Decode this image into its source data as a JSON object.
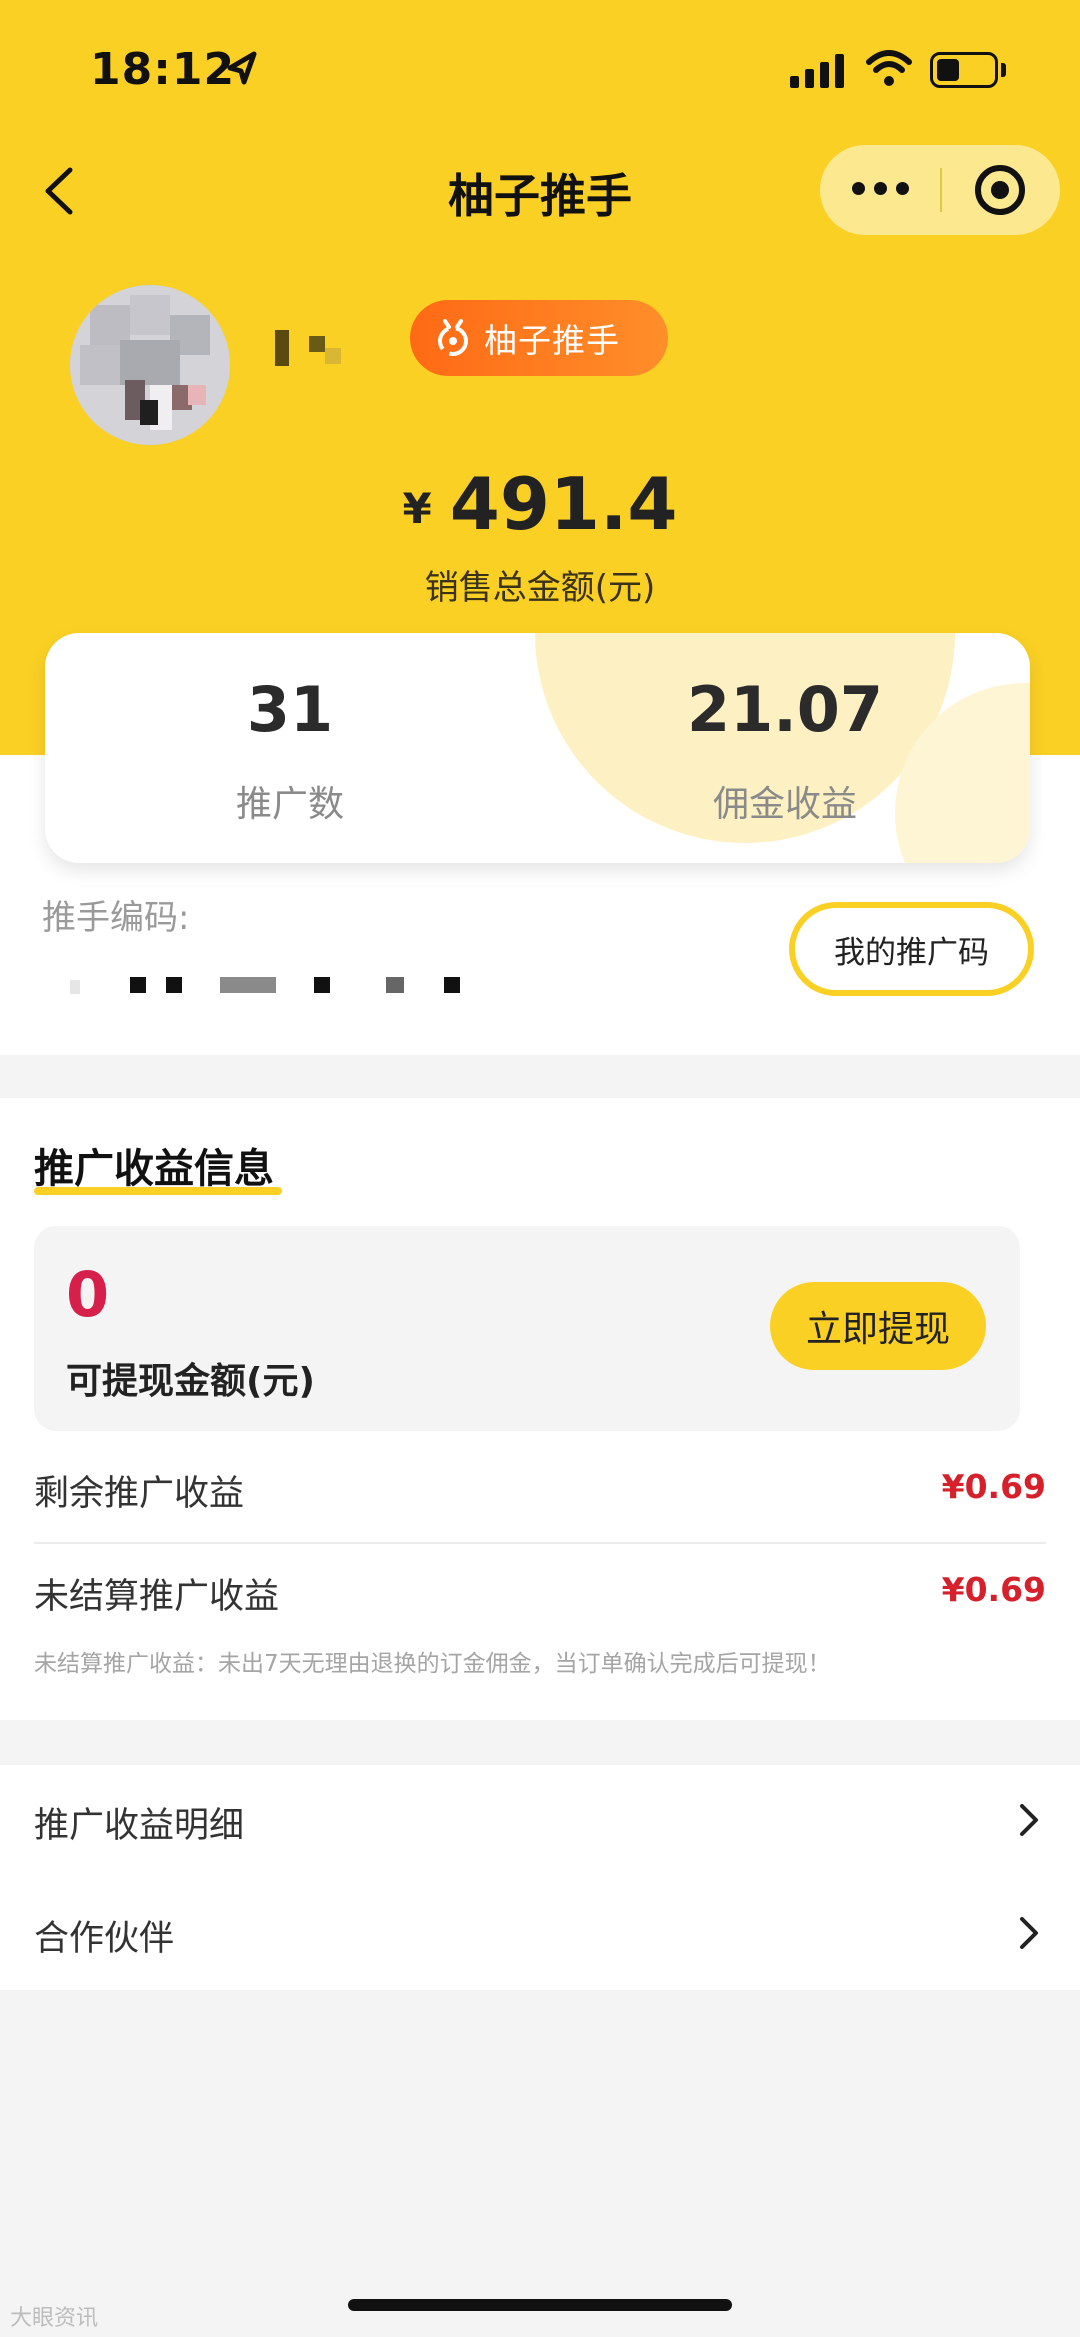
{
  "status_bar": {
    "time": "18:12"
  },
  "header": {
    "title": "柚子推手"
  },
  "profile": {
    "badge_label": "柚子推手"
  },
  "summary": {
    "currency_symbol": "¥",
    "total_sales": "491.4",
    "total_sales_label": "销售总金额(元)"
  },
  "stats": [
    {
      "value": "31",
      "label": "推广数"
    },
    {
      "value": "21.07",
      "label": "佣金收益"
    }
  ],
  "promoter": {
    "code_label": "推手编码:",
    "my_code_button": "我的推广码"
  },
  "earnings": {
    "section_title": "推广收益信息",
    "withdrawable_amount": "0",
    "withdrawable_label": "可提现金额(元)",
    "withdraw_button": "立即提现",
    "rows": [
      {
        "label": "剩余推广收益",
        "value": "¥0.69"
      },
      {
        "label": "未结算推广收益",
        "value": "¥0.69"
      }
    ],
    "note": "未结算推广收益：未出7天无理由退换的订金佣金，当订单确认完成后可提现！"
  },
  "links": [
    {
      "label": "推广收益明细"
    },
    {
      "label": "合作伙伴"
    }
  ],
  "watermark": "大眼资讯",
  "colors": {
    "brand_yellow": "#fbd024",
    "badge_orange": "#ff7a1f",
    "accent_red": "#d6204b"
  }
}
